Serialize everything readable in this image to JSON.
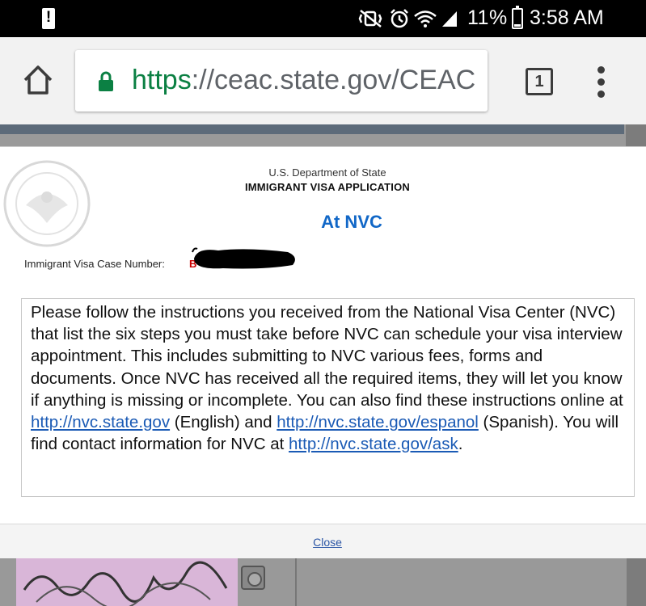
{
  "status_bar": {
    "battery_percent": "11%",
    "time": "3:58 AM",
    "icons": [
      "alert-icon",
      "vibrate-mute-icon",
      "alarm-icon",
      "wifi-icon",
      "signal-icon",
      "battery-icon"
    ]
  },
  "browser": {
    "url_scheme": "https",
    "url_rest": "://ceac.state.gov/CEAC",
    "tab_count": "1",
    "colors": {
      "secure_green": "#0b8043",
      "url_gray": "#5f6368"
    }
  },
  "modal": {
    "department": "U.S. Department of State",
    "application_title": "IMMIGRANT VISA APPLICATION",
    "status": "At NVC",
    "case_number_label": "Immigrant Visa Case Number:",
    "case_number_visible": "B",
    "message": {
      "part1": "Please follow the instructions you received from the National Visa Center (NVC) that list the six steps you must take before NVC can schedule your visa interview appointment. This includes submitting to NVC various fees, forms and documents. Once NVC has received all the required items, they will let you know if anything is missing or incomplete. You can also find these instructions online at ",
      "link1": "http://nvc.state.gov",
      "part2": " (English) and ",
      "link2": "http://nvc.state.gov/espanol",
      "part3": " (Spanish). You will find contact information for NVC at ",
      "link3": "http://nvc.state.gov/ask",
      "part4": "."
    },
    "close_label": "Close",
    "colors": {
      "status_blue": "#1167c7",
      "link_blue": "#1a5ab5"
    }
  }
}
